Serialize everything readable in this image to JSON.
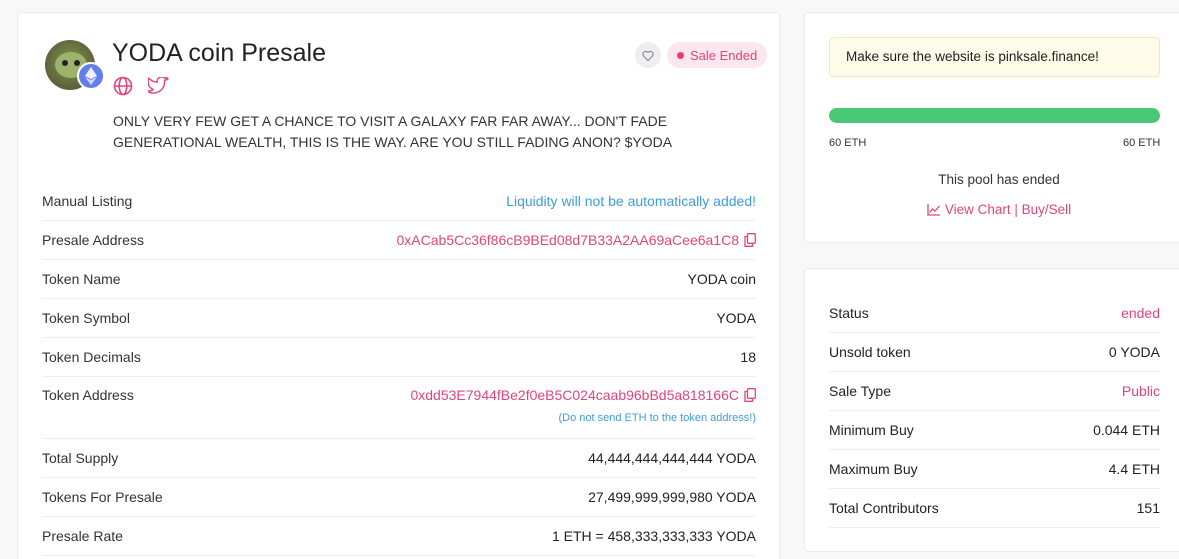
{
  "presale": {
    "title": "YODA coin Presale",
    "status_label": "Sale Ended",
    "description": "ONLY VERY FEW GET A CHANCE TO VISIT A GALAXY FAR FAR AWAY... DON'T FADE GENERATIONAL WEALTH, THIS IS THE WAY. ARE YOU STILL FADING ANON? $YODA"
  },
  "details": [
    {
      "label": "Manual Listing",
      "value": "Liquidity will not be automatically added!"
    },
    {
      "label": "Presale Address",
      "value": "0xACab5Cc36f86cB9BEd08d7B33A2AA69aCee6a1C8"
    },
    {
      "label": "Token Name",
      "value": "YODA coin"
    },
    {
      "label": "Token Symbol",
      "value": "YODA"
    },
    {
      "label": "Token Decimals",
      "value": "18"
    },
    {
      "label": "Token Address",
      "value": "0xdd53E7944fBe2f0eB5C024caab96bBd5a818166C",
      "note": "(Do not send ETH to the token address!)"
    },
    {
      "label": "Total Supply",
      "value": "44,444,444,444,444 YODA"
    },
    {
      "label": "Tokens For Presale",
      "value": "27,499,999,999,980 YODA"
    },
    {
      "label": "Presale Rate",
      "value": "1 ETH = 458,333,333,333 YODA"
    }
  ],
  "sidebar": {
    "warning": "Make sure the website is pinksale.finance!",
    "progress_fraction": 1.0,
    "progress_left": "60 ETH",
    "progress_right": "60 ETH",
    "pool_status": "This pool has ended",
    "chart_link": "View Chart | Buy/Sell"
  },
  "stats": [
    {
      "label": "Status",
      "value": "ended"
    },
    {
      "label": "Unsold token",
      "value": "0 YODA"
    },
    {
      "label": "Sale Type",
      "value": "Public"
    },
    {
      "label": "Minimum Buy",
      "value": "0.044 ETH"
    },
    {
      "label": "Maximum Buy",
      "value": "4.4 ETH"
    },
    {
      "label": "Total Contributors",
      "value": "151"
    }
  ],
  "colors": {
    "accent_pink": "#e0457b",
    "info_blue": "#3d9dd9",
    "progress_green": "#48c774",
    "eth_blue": "#627eea"
  },
  "icons": [
    "ethereum-icon",
    "globe-icon",
    "twitter-icon",
    "heart-icon",
    "copy-icon",
    "chart-line-icon"
  ]
}
